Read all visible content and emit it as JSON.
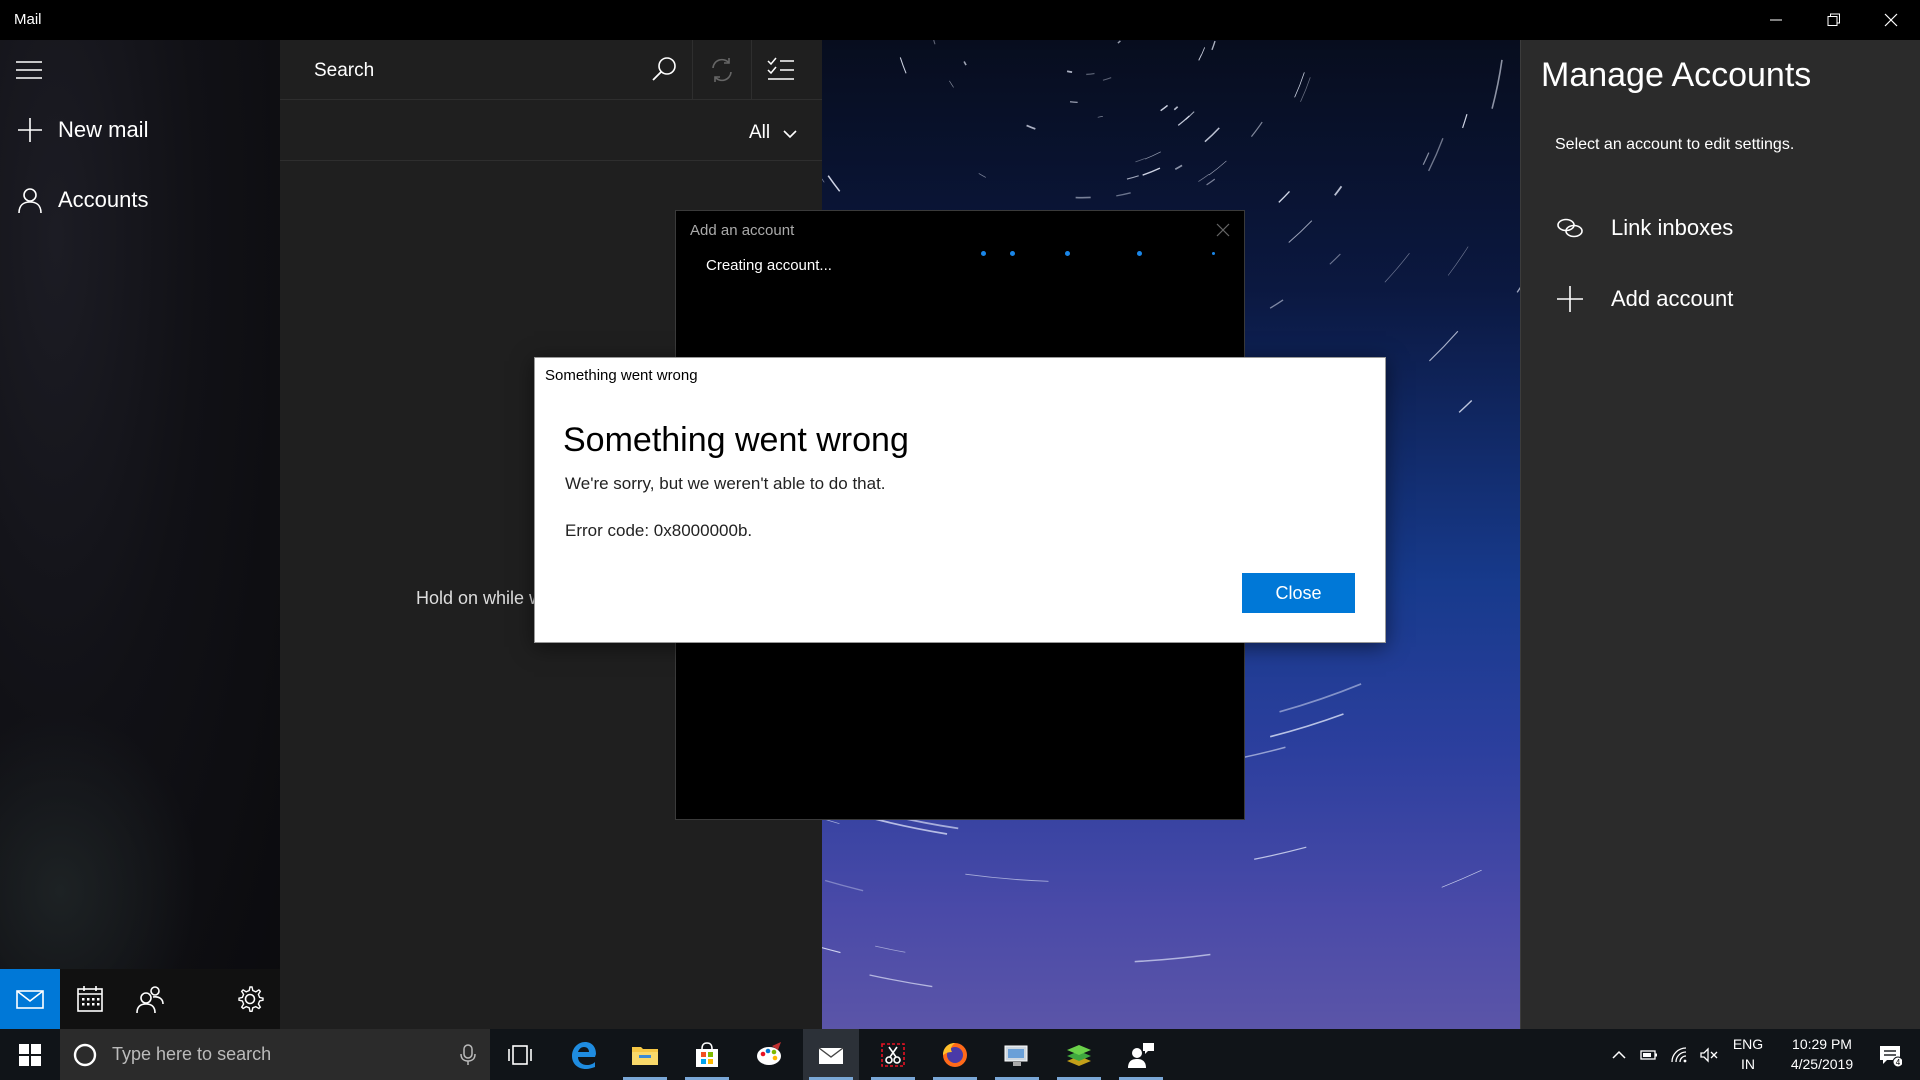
{
  "window": {
    "title": "Mail"
  },
  "nav": {
    "new_mail": "New mail",
    "accounts": "Accounts"
  },
  "maillist": {
    "search_placeholder": "Search",
    "filter": "All",
    "loading_text": "Hold on while w"
  },
  "manage_accounts": {
    "title": "Manage Accounts",
    "subtitle": "Select an account to edit settings.",
    "link_inboxes": "Link inboxes",
    "add_account": "Add account"
  },
  "add_account_dialog": {
    "title": "Add an account",
    "status": "Creating account..."
  },
  "error_dialog": {
    "caption": "Something went wrong",
    "heading": "Something went wrong",
    "message": "We're sorry, but we weren't able to do that.",
    "error_code": "Error code: 0x8000000b.",
    "close_label": "Close"
  },
  "taskbar": {
    "search_placeholder": "Type here to search",
    "language_top": "ENG",
    "language_bottom": "IN",
    "time": "10:29 PM",
    "date": "4/25/2019",
    "notification_count": "4"
  },
  "colors": {
    "accent": "#0078d7",
    "dialog_bg": "#ffffff",
    "pane_bg": "#2b2b2b"
  }
}
